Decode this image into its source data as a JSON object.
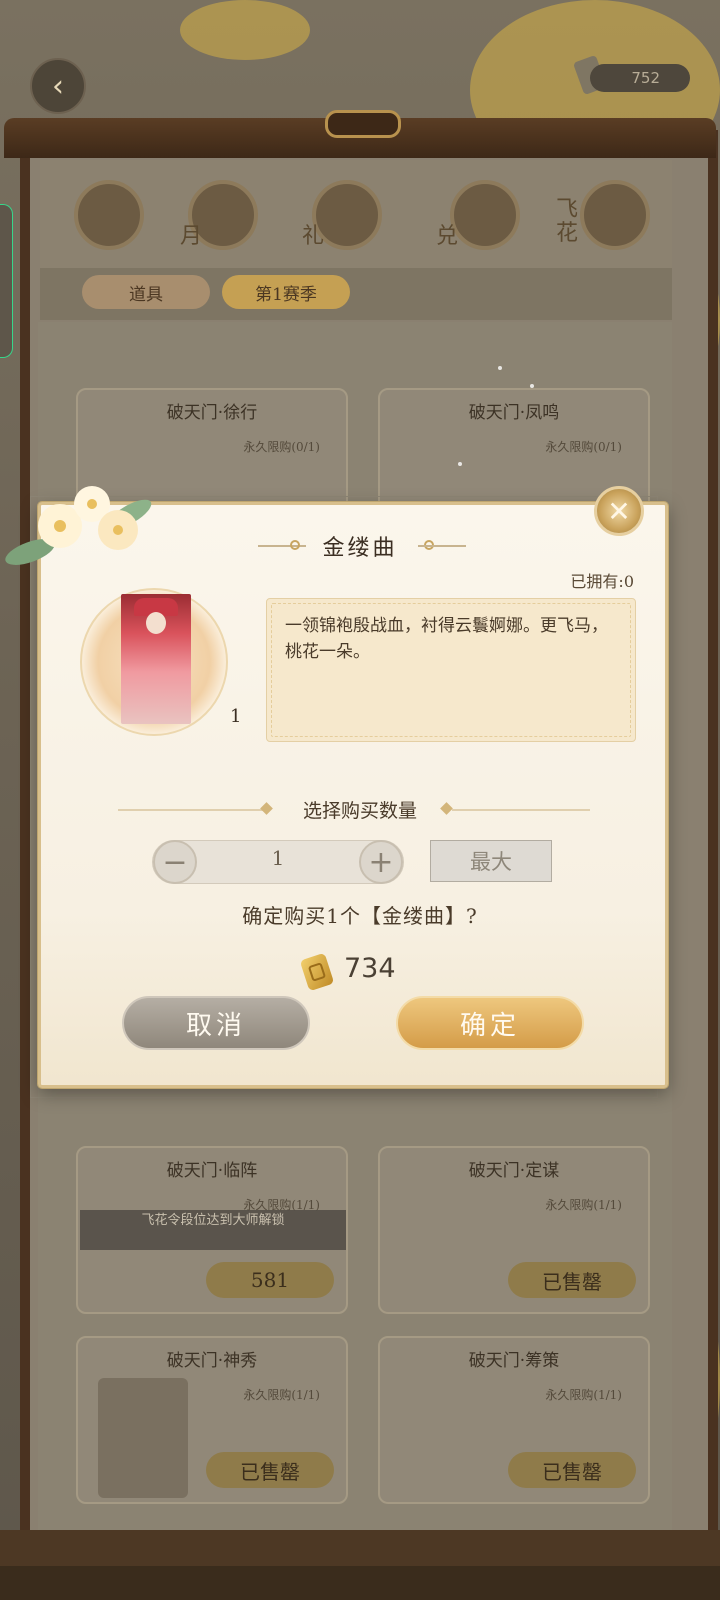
{
  "header": {
    "currency_value": "752"
  },
  "categories": [
    {
      "label": ""
    },
    {
      "label": "月"
    },
    {
      "label": "礼"
    },
    {
      "label": "兑"
    },
    {
      "label": "飞花"
    }
  ],
  "sub_tabs": [
    {
      "label": "道具"
    },
    {
      "label": "第1赛季"
    }
  ],
  "cards": [
    {
      "title": "破天门·徐行",
      "limit": "永久限购(0/1)"
    },
    {
      "title": "破天门·凤鸣",
      "limit": "永久限购(0/1)"
    },
    {
      "title": "破天门·临阵",
      "limit": "永久限购(1/1)",
      "locked_text": "飞花令段位达到大师解锁",
      "price": "581"
    },
    {
      "title": "破天门·定谋",
      "limit": "永久限购(1/1)",
      "status": "已售罄"
    },
    {
      "title": "破天门·神秀",
      "limit": "永久限购(1/1)",
      "status": "已售罄"
    },
    {
      "title": "破天门·筹策",
      "limit": "永久限购(1/1)",
      "status": "已售罄"
    }
  ],
  "modal": {
    "title": "金缕曲",
    "owned_label": "已拥有:0",
    "item_quantity": "1",
    "description": "一领锦袍殷战血，衬得云鬟婀娜。更飞马，桃花一朵。",
    "quantity_header": "选择购买数量",
    "quantity_value": "1",
    "minus_label": "−",
    "plus_label": "+",
    "max_label": "最大",
    "confirm_text": "确定购买1个【金缕曲】?",
    "cost": "734",
    "cancel_label": "取消",
    "ok_label": "确定",
    "close_label": "✕"
  },
  "colors": {
    "accent_gold": "#d49c48",
    "cancel_gray": "#8f877b",
    "modal_bg": "#fbf6ec"
  }
}
